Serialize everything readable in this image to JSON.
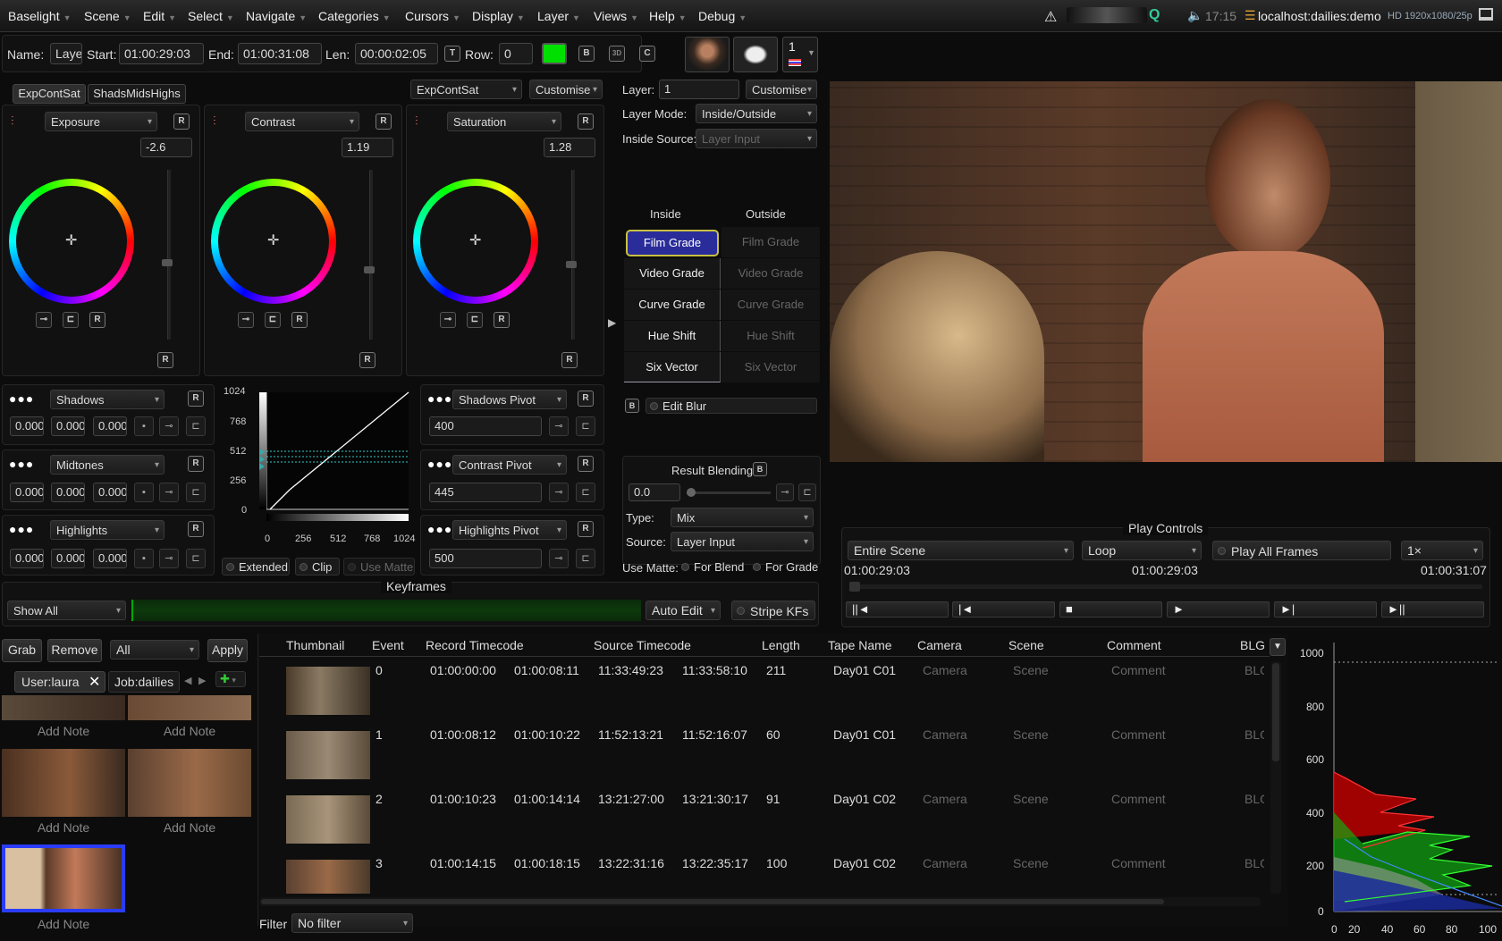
{
  "menubar": {
    "items": [
      "Baselight",
      "Scene",
      "Edit",
      "Select",
      "Navigate",
      "Categories",
      "Cursors",
      "Display",
      "Layer",
      "Views",
      "Help",
      "Debug"
    ],
    "time": "17:15",
    "host": "localhost:dailies:demo",
    "format": "HD 1920x1080/25p"
  },
  "header": {
    "name_label": "Name:",
    "name_value": "Layer",
    "start_label": "Start:",
    "start_value": "01:00:29:03",
    "end_label": "End:",
    "end_value": "01:00:31:08",
    "len_label": "Len:",
    "len_value": "00:00:02:05",
    "row_label": "Row:",
    "row_value": "0",
    "count": "1",
    "btn_t": "T",
    "btn_b": "B",
    "btn_3d": "3D",
    "btn_c": "C"
  },
  "grade": {
    "tab1": "ExpContSat",
    "tab2": "ShadsMidsHighs",
    "preset": "ExpContSat",
    "customise": "Customise",
    "wheels": [
      {
        "name": "Exposure",
        "value": "-2.6"
      },
      {
        "name": "Contrast",
        "value": "1.19"
      },
      {
        "name": "Saturation",
        "value": "1.28"
      }
    ],
    "tone_rows": [
      {
        "name": "Shadows",
        "v": [
          "0.000",
          "0.000",
          "0.000"
        ]
      },
      {
        "name": "Midtones",
        "v": [
          "0.000",
          "0.000",
          "0.000"
        ]
      },
      {
        "name": "Highlights",
        "v": [
          "0.000",
          "0.000",
          "0.000"
        ]
      }
    ],
    "pivots": [
      {
        "name": "Shadows Pivot",
        "value": "400"
      },
      {
        "name": "Contrast Pivot",
        "value": "445"
      },
      {
        "name": "Highlights Pivot",
        "value": "500"
      }
    ],
    "curve_y_ticks": [
      "1024",
      "768",
      "512",
      "256",
      "0"
    ],
    "curve_x_ticks": [
      "0",
      "256",
      "512",
      "768",
      "1024"
    ],
    "extended": "Extended",
    "clip": "Clip",
    "use_matte": "Use Matte",
    "r": "R"
  },
  "layer": {
    "layer_label": "Layer:",
    "layer_value": "1",
    "customise": "Customise",
    "mode_label": "Layer Mode:",
    "mode_value": "Inside/Outside",
    "source_label": "Inside Source:",
    "source_value": "Layer Input",
    "inside": "Inside",
    "outside": "Outside",
    "grades": [
      "Film Grade",
      "Video Grade",
      "Curve Grade",
      "Hue Shift",
      "Six Vector"
    ],
    "edit_blur": "Edit Blur",
    "result_blending": "Result Blending",
    "blend_value": "0.0",
    "type_label": "Type:",
    "type_value": "Mix",
    "source2_label": "Source:",
    "source2_value": "Layer Input",
    "use_matte": "Use Matte:",
    "for_blend": "For Blend",
    "for_grade": "For Grade"
  },
  "keyframes": {
    "title": "Keyframes",
    "show": "Show All",
    "auto_edit": "Auto Edit",
    "stripe": "Stripe KFs"
  },
  "play": {
    "title": "Play Controls",
    "range": "Entire Scene",
    "mode": "Loop",
    "play_all": "Play All Frames",
    "speed": "1×",
    "tc_left": "01:00:29:03",
    "tc_mid": "01:00:29:03",
    "tc_right": "01:00:31:07",
    "buttons": [
      "||◄",
      "|◄",
      "■",
      "►",
      "►|",
      "►||"
    ]
  },
  "browser": {
    "grab": "Grab",
    "remove": "Remove",
    "all": "All",
    "apply": "Apply",
    "user_tab": "User:laura",
    "job_tab": "Job:dailies",
    "add_note": "Add Note"
  },
  "table": {
    "headers": [
      "Thumbnail",
      "Event",
      "Record Timecode",
      "Source Timecode",
      "Length",
      "Tape Name",
      "Camera",
      "Scene",
      "Comment",
      "BLG"
    ],
    "rows": [
      {
        "event": "0",
        "rec_in": "01:00:00:00",
        "rec_out": "01:00:08:11",
        "src_in": "11:33:49:23",
        "src_out": "11:33:58:10",
        "len": "211",
        "tape": "Day01 C01",
        "cam": "Camera",
        "scene": "Scene",
        "comment": "Comment",
        "blg": "BLG"
      },
      {
        "event": "1",
        "rec_in": "01:00:08:12",
        "rec_out": "01:00:10:22",
        "src_in": "11:52:13:21",
        "src_out": "11:52:16:07",
        "len": "60",
        "tape": "Day01 C01",
        "cam": "Camera",
        "scene": "Scene",
        "comment": "Comment",
        "blg": "BLG"
      },
      {
        "event": "2",
        "rec_in": "01:00:10:23",
        "rec_out": "01:00:14:14",
        "src_in": "13:21:27:00",
        "src_out": "13:21:30:17",
        "len": "91",
        "tape": "Day01 C02",
        "cam": "Camera",
        "scene": "Scene",
        "comment": "Comment",
        "blg": "BLG"
      },
      {
        "event": "3",
        "rec_in": "01:00:14:15",
        "rec_out": "01:00:18:15",
        "src_in": "13:22:31:16",
        "src_out": "13:22:35:17",
        "len": "100",
        "tape": "Day01 C02",
        "cam": "Camera",
        "scene": "Scene",
        "comment": "Comment",
        "blg": "BLG"
      }
    ],
    "filter_label": "Filter",
    "filter_value": "No filter"
  },
  "histogram": {
    "y_ticks": [
      "1000",
      "800",
      "600",
      "400",
      "200",
      "0"
    ],
    "x_ticks": [
      "0",
      "20",
      "40",
      "60",
      "80",
      "100"
    ]
  },
  "colors": {
    "accent_green": "#00e000",
    "selected_blue": "#2a3cff",
    "film_grade_highlight": "#c8c040"
  }
}
